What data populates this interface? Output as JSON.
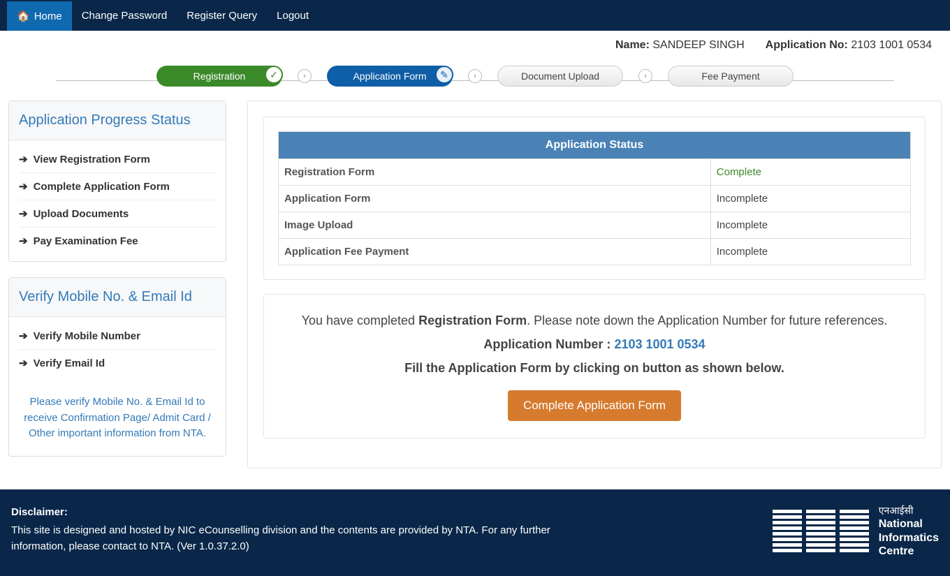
{
  "nav": {
    "home": "Home",
    "change_password": "Change Password",
    "register_query": "Register Query",
    "logout": "Logout"
  },
  "info": {
    "name_label": "Name:",
    "name_value": "SANDEEP SINGH",
    "appno_label": "Application No:",
    "appno_value": "2103 1001 0534"
  },
  "steps": {
    "registration": "Registration",
    "application": "Application Form",
    "upload": "Document Upload",
    "payment": "Fee Payment"
  },
  "sidebar": {
    "progress_header": "Application Progress Status",
    "items": [
      "View Registration Form",
      "Complete Application Form",
      "Upload Documents",
      "Pay Examination Fee"
    ],
    "verify_header": "Verify Mobile No. & Email Id",
    "verify_items": [
      "Verify Mobile Number",
      "Verify Email Id"
    ],
    "verify_note": "Please verify Mobile No. & Email Id to receive Confirmation Page/ Admit Card / Other important information from NTA."
  },
  "status": {
    "header": "Application Status",
    "rows": [
      {
        "label": "Registration Form",
        "value": "Complete",
        "complete": true
      },
      {
        "label": "Application Form",
        "value": "Incomplete"
      },
      {
        "label": "Image Upload",
        "value": "Incomplete"
      },
      {
        "label": "Application Fee Payment",
        "value": "Incomplete"
      }
    ]
  },
  "message": {
    "line1_prefix": "You have completed ",
    "line1_bold": "Registration Form",
    "line1_suffix": ". Please note down the Application Number for future references.",
    "line2_label": "Application Number : ",
    "line2_value": "2103 1001 0534",
    "line3": "Fill the Application Form by clicking on button as shown below.",
    "button": "Complete Application Form"
  },
  "footer": {
    "disclaimer_label": "Disclaimer:",
    "disclaimer_text": "This site is designed and hosted by NIC eCounselling division and the contents are provided by NTA. For any further information, please contact to NTA. (Ver 1.0.37.2.0)",
    "nic_hindi": "एनआईसी",
    "nic_line1": "National",
    "nic_line2": "Informatics",
    "nic_line3": "Centre"
  }
}
